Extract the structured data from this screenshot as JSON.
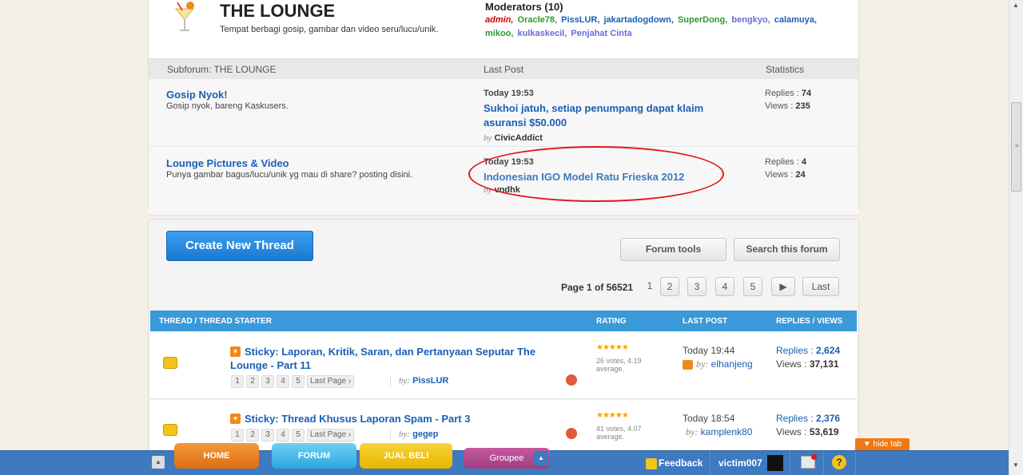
{
  "lounge": {
    "title": "THE LOUNGE",
    "description": "Tempat berbagi gosip, gambar dan video seru/lucu/unik.",
    "moderators_title": "Moderators (10)",
    "moderators": [
      {
        "name": "admin",
        "color": "#cc0000"
      },
      {
        "name": "Oracle78",
        "color": "#2a9a2a"
      },
      {
        "name": "PissLUR",
        "color": "#1a5fb4"
      },
      {
        "name": "jakartadogdown",
        "color": "#1a5fb4"
      },
      {
        "name": "SuperDong",
        "color": "#2a9a2a"
      },
      {
        "name": "bengkyo",
        "color": "#6a6ad8"
      },
      {
        "name": "calamuya",
        "color": "#1a5fb4"
      },
      {
        "name": "mikoo",
        "color": "#2a9a2a"
      },
      {
        "name": "kulkaskecil",
        "color": "#6a6ad8"
      },
      {
        "name": "Penjahat Cinta",
        "color": "#6a6ad8"
      }
    ]
  },
  "subforum_header": {
    "col1": "Subforum: THE LOUNGE",
    "col2": "Last Post",
    "col3": "Statistics"
  },
  "subforums": [
    {
      "name": "Gosip Nyok!",
      "desc": "Gosip nyok, bareng Kaskusers.",
      "lp_time": "Today 19:53",
      "lp_title": "Sukhoi jatuh, setiap penumpang dapat klaim asuransi $50.000",
      "lp_by_label": "by",
      "lp_by": "CivicAddict",
      "replies_label": "Replies :",
      "replies": "74",
      "views_label": "Views :",
      "views": "235"
    },
    {
      "name": "Lounge Pictures & Video",
      "desc": "Punya gambar bagus/lucu/unik yg mau di share? posting disini.",
      "lp_time": "Today 19:53",
      "lp_title": "Indonesian IGO Model Ratu Frieska 2012",
      "lp_by_label": "by",
      "lp_by": "vndhk",
      "replies_label": "Replies :",
      "replies": "4",
      "views_label": "Views :",
      "views": "24"
    }
  ],
  "toolbar": {
    "create_thread": "Create New Thread",
    "forum_tools": "Forum tools",
    "search_forum": "Search this forum"
  },
  "pager": {
    "label": "Page 1 of 56521",
    "current": "1",
    "pages": [
      "2",
      "3",
      "4",
      "5"
    ],
    "next": "▶",
    "last": "Last"
  },
  "thread_header": {
    "col1": "THREAD / THREAD STARTER",
    "col2": "RATING",
    "col3": "LAST POST",
    "col4": "REPLIES / VIEWS"
  },
  "threads": [
    {
      "title": "Sticky: Laporan, Kritik, Saran, dan Pertanyaan Seputar The Lounge - Part 11",
      "pages": [
        "1",
        "2",
        "3",
        "4",
        "5",
        "Last Page ›"
      ],
      "by_label": "by:",
      "starter": "PissLUR",
      "stars": "★★★★★",
      "votes": "26 votes, 4.19 average.",
      "lp_time": "Today 19:44",
      "lp_by_label": "by:",
      "lp_by": "elhanjeng",
      "replies_label": "Replies :",
      "replies": "2,624",
      "views_label": "Views :",
      "views": "37,131"
    },
    {
      "title": "Sticky: Thread Khusus Laporan Spam - Part 3",
      "pages": [
        "1",
        "2",
        "3",
        "4",
        "5",
        "Last Page ›"
      ],
      "by_label": "by:",
      "starter": "gegep",
      "stars": "★★★★★",
      "votes": "41 votes, 4.07 average.",
      "lp_time": "Today 18:54",
      "lp_by_label": "by:",
      "lp_by": "kamplenk80",
      "replies_label": "Replies :",
      "replies": "2,376",
      "views_label": "Views :",
      "views": "53,619"
    }
  ],
  "bottombar": {
    "home": "HOME",
    "forum": "FORUM",
    "jual_beli": "JUAL BELI",
    "groupee": "Groupee",
    "feedback": "Feedback",
    "username": "victim007",
    "help": "?",
    "hide_tab": "▼ hide tab"
  }
}
